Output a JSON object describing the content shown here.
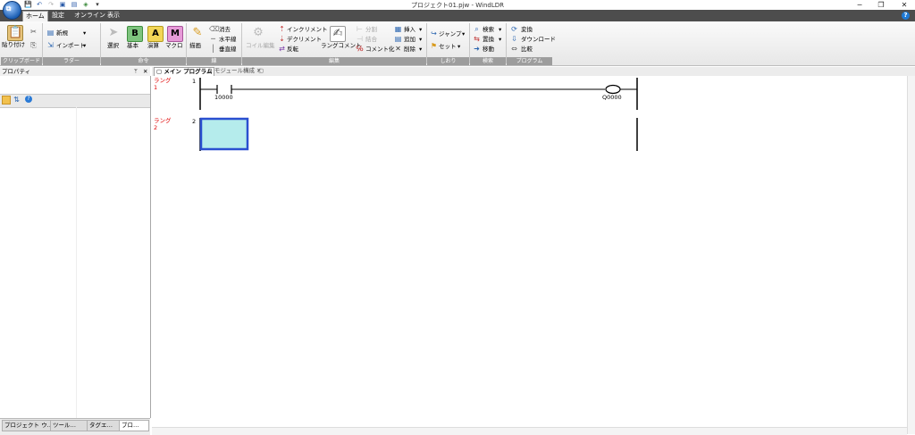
{
  "window": {
    "title": "プロジェクト01.pjw - WindLDR",
    "minimize": "─",
    "maximize": "❐",
    "close": "✕"
  },
  "quick_access": [
    "💾",
    "↶",
    "↷",
    "▣",
    "▤",
    "◈",
    "▾"
  ],
  "menu_tabs": [
    "ホーム",
    "設定",
    "オンライン",
    "表示"
  ],
  "ribbon": {
    "clipboard": {
      "label": "クリップボード",
      "paste": "貼り付け"
    },
    "rung": {
      "label": "ラダー",
      "new": "新規",
      "import": "インポート"
    },
    "instruction": {
      "label": "命令",
      "select": "選択",
      "basic": "基本",
      "calc": "演算",
      "macro": "マクロ",
      "b_letter": "B",
      "a_letter": "A",
      "m_letter": "M"
    },
    "line": {
      "label": "線",
      "draw": "描画",
      "erase": "消去",
      "horizontal": "水平線",
      "vertical": "垂直線"
    },
    "edit": {
      "label": "編集",
      "coil_edit": "コイル編集",
      "increment": "インクリメント",
      "decrement": "デクリメント",
      "invert": "反転",
      "rung_comment": "ラングコメント",
      "split": "分割",
      "merge": "結合",
      "comment_out": "コメント化",
      "insert": "挿入",
      "add": "追加",
      "delete": "削除"
    },
    "bookmark": {
      "label": "しおり",
      "jump": "ジャンプ",
      "set": "セット"
    },
    "search": {
      "label": "検索",
      "find": "検索",
      "replace": "置換",
      "move": "移動"
    },
    "program": {
      "label": "プログラム",
      "convert": "変換",
      "download": "ダウンロード",
      "compare": "比較"
    }
  },
  "properties_panel": {
    "title": "プロパティ",
    "pin": "ᛘ",
    "close": "✕",
    "bottom_tabs": [
      "プロジェクト ウ…",
      "ツール…",
      "タグエ…",
      "ブロ…"
    ]
  },
  "editor": {
    "tabs": [
      "メイン プログラム",
      "モジュール構成"
    ],
    "rungs": [
      {
        "label": "ラング",
        "index": "1",
        "number": "1",
        "contact": "10000",
        "coil": "Q0000"
      },
      {
        "label": "ラング",
        "index": "2",
        "number": "2"
      }
    ]
  }
}
